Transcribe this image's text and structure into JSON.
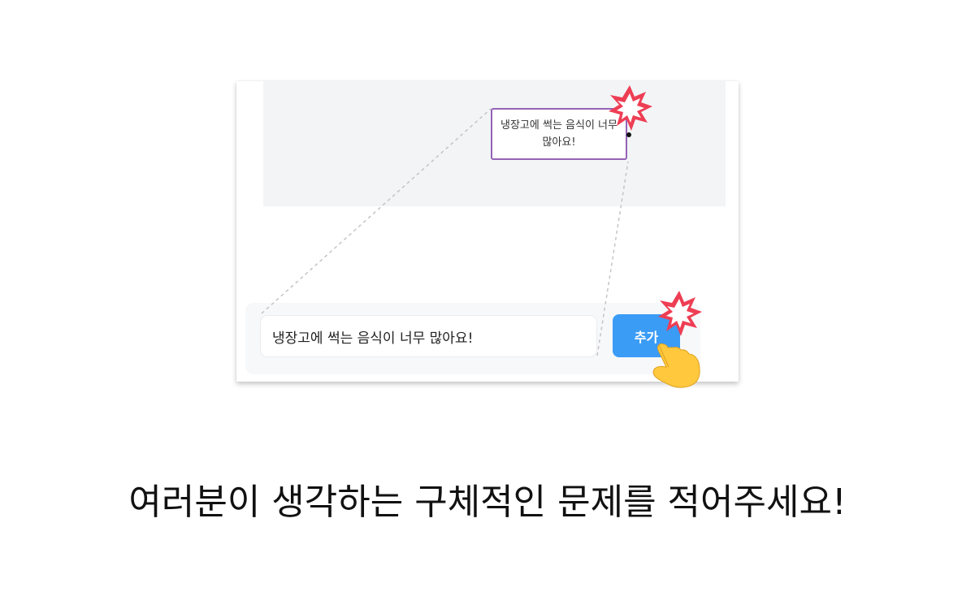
{
  "sticky_note": {
    "text": "냉장고에 썩는 음식이 너무 많아요!"
  },
  "todo_form": {
    "input_value": "냉장고에 썩는 음식이 너무 많아요!",
    "add_label": "추가"
  },
  "caption": "여러분이 생각하는 구체적인 문제를 적어주세요!",
  "colors": {
    "accent_blue": "#3b9cf6",
    "note_border": "#9463b8",
    "burst_red": "#ee3e54",
    "hand_yellow": "#ffc83d"
  },
  "icons": [
    "burst-icon",
    "pointing-hand-icon"
  ]
}
